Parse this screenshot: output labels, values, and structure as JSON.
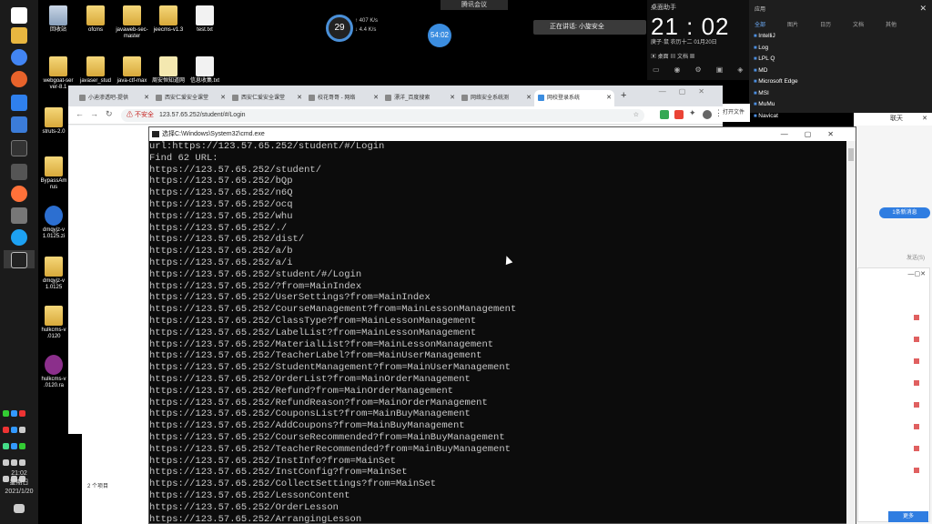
{
  "taskbar": {
    "clock_time": "21:02",
    "clock_day": "星期日",
    "clock_date": "2021/1/20"
  },
  "desktop": {
    "icons": [
      {
        "label": "回收站",
        "kind": "bin"
      },
      {
        "label": "ofcms",
        "kind": "folder"
      },
      {
        "label": "javaweb-sec-master",
        "kind": "folder"
      },
      {
        "label": "jeecms-v1.3",
        "kind": "folder"
      },
      {
        "label": "test.txt",
        "kind": "doc"
      },
      {
        "label": "webgoat-ser ver-8.1",
        "kind": "folder"
      },
      {
        "label": "javaser_stud",
        "kind": "folder"
      },
      {
        "label": "java-ctf-max",
        "kind": "folder"
      },
      {
        "label": "周安恒知道网",
        "kind": "doc"
      },
      {
        "label": "信息收集.txt",
        "kind": "doc"
      },
      {
        "label": "struts-2.0",
        "kind": "folder"
      },
      {
        "label": "BypassAm rus",
        "kind": "folder"
      },
      {
        "label": "dmqyjz-v 1.0125.zi",
        "kind": "zip"
      },
      {
        "label": "dmqyjz-v 1.0125",
        "kind": "folder"
      },
      {
        "label": "hulkcms-v .0120",
        "kind": "folder"
      },
      {
        "label": "hulkcms-v .0120.ra",
        "kind": "rar"
      }
    ]
  },
  "widgets": {
    "gauge_value": "29",
    "net_up": "↑ 407 K/s",
    "net_down": "↓ 4.4 K/s",
    "timer": "54:02",
    "meeting_label": "腾讯会议",
    "speaking": "正在讲话: 小旋安全"
  },
  "clock_widget": {
    "caption": "桌面助手",
    "time": "21 : 02",
    "meta": "庚子·鼠    农历十二    01月20日",
    "row2": "▣ 桌面      ▤ 文档      ▦"
  },
  "start_panel": {
    "header": "应用",
    "tabs": [
      "全部",
      "图片",
      "日历",
      "文档",
      "其他"
    ],
    "apps": [
      "IntelliJ",
      "Log",
      "LPL Q",
      "MD",
      "Microsoft Edge",
      "MSI",
      "MuMu",
      "Navicat"
    ]
  },
  "chrome": {
    "tabs": [
      "小迪渗透吧-提供",
      "西安仁爱安全课堂",
      "西安仁爱安全课堂",
      "校花哥哥 - 网络",
      "漂洋_百度搜索",
      "网络安全系统测",
      "网校登录系统"
    ],
    "active_tab": 6,
    "url_insecure": "不安全",
    "url": "123.57.65.252/student/#/Login"
  },
  "explorer": {
    "item_count": "2 个项目"
  },
  "filebar": {
    "label": "打开文件"
  },
  "chat": {
    "title": "联天",
    "pill": "1条新消息",
    "send": "发送(S)",
    "more": "更多"
  },
  "cmd": {
    "title": "选择C:\\Windows\\System32\\cmd.exe",
    "lines": [
      "url:https://123.57.65.252/student/#/Login",
      "Find 62 URL:",
      "https://123.57.65.252/student/",
      "https://123.57.65.252/bQp",
      "https://123.57.65.252/n6Q",
      "https://123.57.65.252/ocq",
      "https://123.57.65.252/whu",
      "https://123.57.65.252/./",
      "https://123.57.65.252/dist/",
      "https://123.57.65.252/a/b",
      "https://123.57.65.252/a/i",
      "https://123.57.65.252/student/#/Login",
      "https://123.57.65.252/?from=MainIndex",
      "https://123.57.65.252/UserSettings?from=MainIndex",
      "https://123.57.65.252/CourseManagement?from=MainLessonManagement",
      "https://123.57.65.252/ClassType?from=MainLessonManagement",
      "https://123.57.65.252/LabelList?from=MainLessonManagement",
      "https://123.57.65.252/MaterialList?from=MainLessonManagement",
      "https://123.57.65.252/TeacherLabel?from=MainUserManagement",
      "https://123.57.65.252/StudentManagement?from=MainUserManagement",
      "https://123.57.65.252/OrderList?from=MainOrderManagement",
      "https://123.57.65.252/Refund?from=MainOrderManagement",
      "https://123.57.65.252/RefundReason?from=MainOrderManagement",
      "https://123.57.65.252/CouponsList?from=MainBuyManagement",
      "https://123.57.65.252/AddCoupons?from=MainBuyManagement",
      "https://123.57.65.252/CourseRecommended?from=MainBuyManagement",
      "https://123.57.65.252/TeacherRecommended?from=MainBuyManagement",
      "https://123.57.65.252/InstInfo?from=MainSet",
      "https://123.57.65.252/InstConfig?from=MainSet",
      "https://123.57.65.252/CollectSettings?from=MainSet",
      "https://123.57.65.252/LessonContent",
      "https://123.57.65.252/OrderLesson",
      "https://123.57.65.252/ArrangingLesson"
    ]
  }
}
